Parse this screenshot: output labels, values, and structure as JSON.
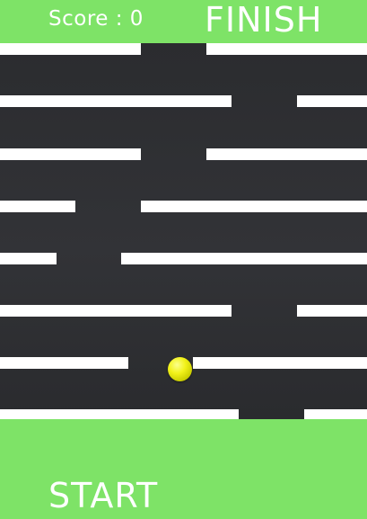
{
  "hud": {
    "score_label": "Score : 0",
    "finish_label": "FINISH",
    "start_label": "START"
  },
  "colors": {
    "zone_green": "#7ee367",
    "maze_floor": "#2d2e31",
    "wall": "#ffffff",
    "ball": "#f2f21a"
  }
}
